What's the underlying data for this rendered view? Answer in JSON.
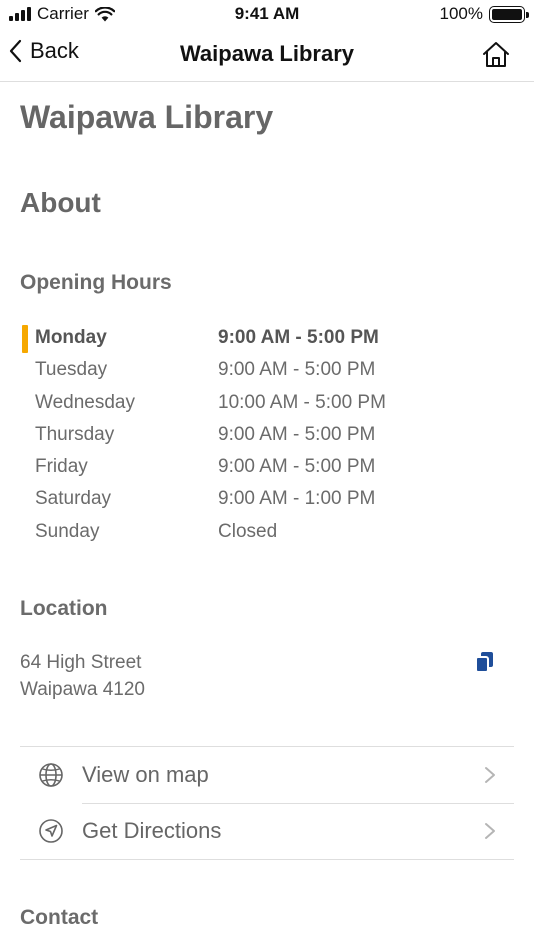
{
  "status_bar": {
    "carrier": "Carrier",
    "time": "9:41 AM",
    "battery": "100%",
    "battery_level": 1.0
  },
  "nav": {
    "back_label": "Back",
    "title": "Waipawa Library",
    "back_icon": "chevron-left-icon",
    "home_icon": "home-icon"
  },
  "page": {
    "title": "Waipawa Library",
    "about_heading": "About",
    "hours_heading": "Opening Hours",
    "hours": [
      {
        "day": "Monday",
        "time": "9:00 AM - 5:00 PM",
        "today": true
      },
      {
        "day": "Tuesday",
        "time": "9:00 AM - 5:00 PM",
        "today": false
      },
      {
        "day": "Wednesday",
        "time": "10:00 AM - 5:00 PM",
        "today": false
      },
      {
        "day": "Thursday",
        "time": "9:00 AM - 5:00 PM",
        "today": false
      },
      {
        "day": "Friday",
        "time": "9:00 AM - 5:00 PM",
        "today": false
      },
      {
        "day": "Saturday",
        "time": "9:00 AM - 1:00 PM",
        "today": false
      },
      {
        "day": "Sunday",
        "time": "Closed",
        "today": false
      }
    ],
    "location_heading": "Location",
    "address_line1": "64 High Street",
    "address_line2": "Waipawa 4120",
    "copy_icon": "copy-icon",
    "actions": [
      {
        "label": "View on map",
        "icon": "globe-icon"
      },
      {
        "label": "Get Directions",
        "icon": "navigation-icon"
      }
    ],
    "contact_heading": "Contact"
  },
  "colors": {
    "accent_today": "#f6a800",
    "copy_icon": "#1f4e9a",
    "text_primary": "#111111",
    "text_secondary": "#6b6b6b",
    "divider": "#dedede"
  }
}
